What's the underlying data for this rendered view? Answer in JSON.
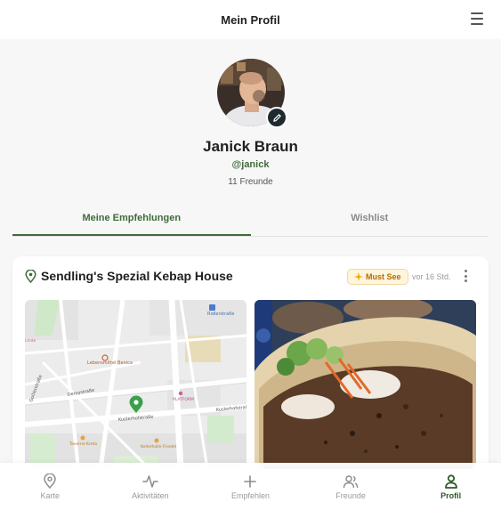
{
  "header": {
    "title": "Mein Profil"
  },
  "profile": {
    "name": "Janick Braun",
    "handle": "@janick",
    "friends": "11 Freunde"
  },
  "tabs": [
    {
      "label": "Meine Empfehlungen",
      "active": true
    },
    {
      "label": "Wishlist",
      "active": false
    }
  ],
  "card": {
    "title": "Sendling's Spezial Kebap House",
    "badge": "Must See",
    "time": "vor 16 Std.",
    "map": {
      "labels": {
        "bus_stop": "Ridlerstraße",
        "lebensmittel": "Lebensmittel Benica",
        "street1": "Deroystraße",
        "street2": "Kusterhofstraße",
        "street3": "Westendstraße",
        "street4": "Gollierstraße",
        "platform": "PLATFORM",
        "side": "Kuslerhofstraße",
        "kebab": "Taverne Kreta",
        "kerbe": "Kellerhalle Friedel",
        "left_pink": "Linde"
      }
    }
  },
  "nav": [
    {
      "label": "Karte",
      "icon": "map-pin-icon",
      "active": false
    },
    {
      "label": "Aktivitäten",
      "icon": "activity-icon",
      "active": false
    },
    {
      "label": "Empfehlen",
      "icon": "plus-icon",
      "active": false
    },
    {
      "label": "Freunde",
      "icon": "friends-icon",
      "active": false
    },
    {
      "label": "Profil",
      "icon": "profile-icon",
      "active": true
    }
  ],
  "colors": {
    "accent": "#3f6b3a",
    "badge_bg": "#fff4dc",
    "badge_text": "#b86a00"
  }
}
